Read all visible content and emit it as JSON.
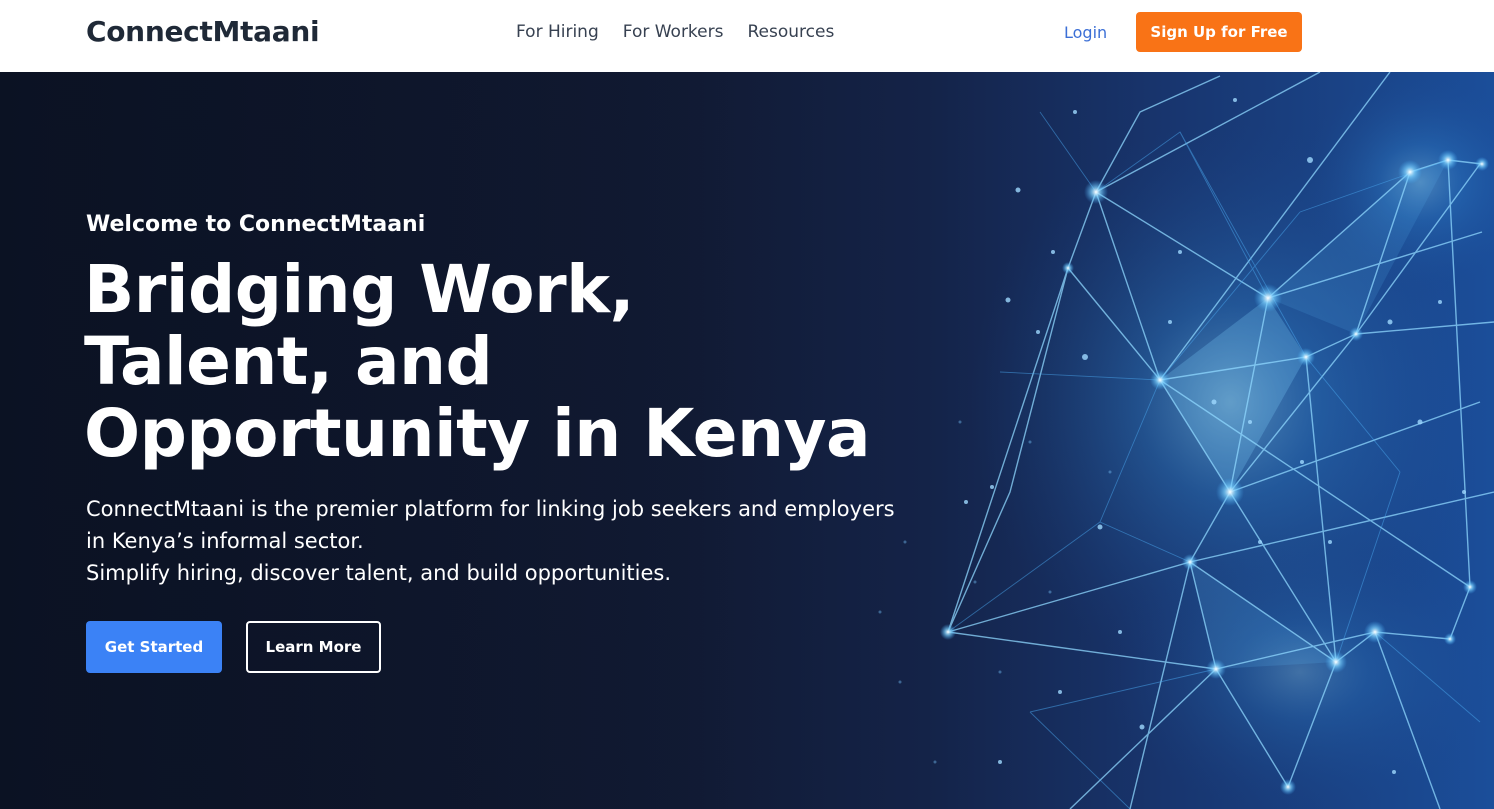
{
  "header": {
    "brand": "ConnectMtaani",
    "nav": [
      {
        "label": "For Hiring"
      },
      {
        "label": "For Workers"
      },
      {
        "label": "Resources"
      }
    ],
    "login_label": "Login",
    "signup_label": "Sign Up for Free"
  },
  "hero": {
    "eyebrow": "Welcome to ConnectMtaani",
    "headline": "Bridging Work, Talent, and Opportunity in Kenya",
    "description_line1": "ConnectMtaani is the premier platform for linking job seekers and employers in Kenya’s informal sector.",
    "description_line2": "Simplify hiring, discover talent, and build opportunities.",
    "primary_cta": "Get Started",
    "secondary_cta": "Learn More",
    "background_image": "glowing-network-mesh"
  },
  "colors": {
    "accent_orange": "#f97316",
    "primary_blue": "#3b82f6",
    "link_blue": "#3b6fd6",
    "hero_dark": "#0b1223",
    "brand_text": "#1f2937"
  }
}
